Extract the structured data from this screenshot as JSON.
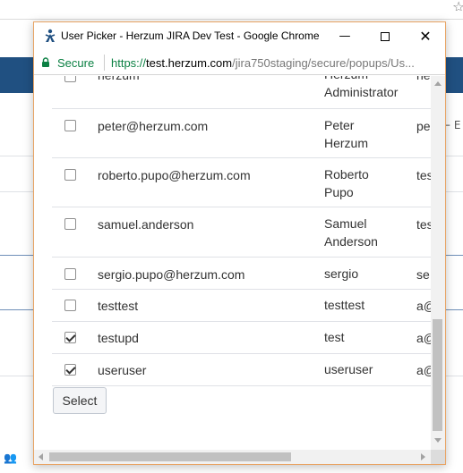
{
  "window": {
    "title": "User Picker - Herzum JIRA Dev Test - Google Chrome",
    "minimize_glyph": "—",
    "close_glyph": "✕"
  },
  "address_bar": {
    "security_label": "Secure",
    "url_scheme": "https://",
    "url_host": "test.herzum.com",
    "url_path": "/jira750staging/secure/popups/Us..."
  },
  "users": [
    {
      "username": "herzum",
      "full_name": "Herzum Administrator",
      "email": "he",
      "checked": false
    },
    {
      "username": "peter@herzum.com",
      "full_name": "Peter Herzum",
      "email": "pe",
      "checked": false
    },
    {
      "username": "roberto.pupo@herzum.com",
      "full_name": "Roberto Pupo",
      "email": "tes",
      "checked": false
    },
    {
      "username": "samuel.anderson",
      "full_name": "Samuel Anderson",
      "email": "tes",
      "checked": false
    },
    {
      "username": "sergio.pupo@herzum.com",
      "full_name": "sergio",
      "email": "se",
      "checked": false
    },
    {
      "username": "testtest",
      "full_name": "testtest",
      "email": "a@",
      "checked": false
    },
    {
      "username": "testupd",
      "full_name": "test",
      "email": "a@",
      "checked": true
    },
    {
      "username": "useruser",
      "full_name": "useruser",
      "email": "a@",
      "checked": true
    }
  ],
  "actions": {
    "select_label": "Select"
  },
  "background": {
    "button_fragment": "⇤ E"
  },
  "colors": {
    "header_blue": "#205081",
    "secure_green": "#0b8043",
    "window_border": "#e8a464"
  }
}
